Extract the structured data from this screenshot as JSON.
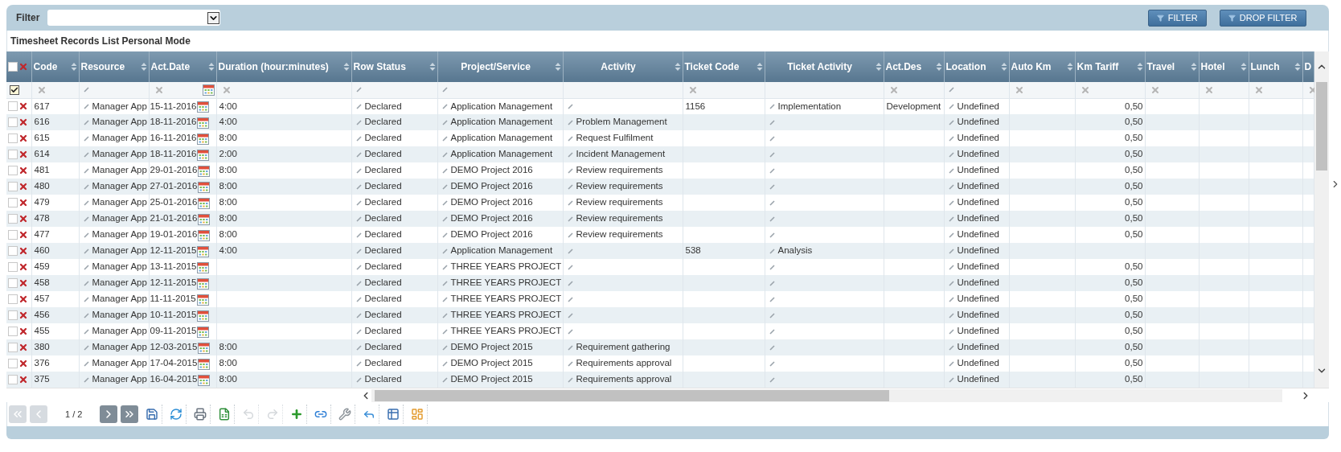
{
  "filter": {
    "label": "Filter"
  },
  "buttons": [
    "FILTER",
    "DROP FILTER"
  ],
  "title": "Timesheet Records List Personal Mode",
  "table": {
    "select_all": {
      "checked": false
    },
    "filter_row": {
      "checked": true,
      "cells": [
        {
          "kind": "clear"
        },
        {
          "kind": "edit"
        },
        {
          "kind": "date"
        },
        {
          "kind": "clear"
        },
        {
          "kind": "edit"
        },
        {
          "kind": "edit"
        },
        {
          "kind": "none"
        },
        {
          "kind": "clear"
        },
        {
          "kind": "none"
        },
        {
          "kind": "clear"
        },
        {
          "kind": "edit"
        },
        {
          "kind": "clear"
        },
        {
          "kind": "clear"
        },
        {
          "kind": "clear"
        },
        {
          "kind": "clear"
        },
        {
          "kind": "clear"
        },
        {
          "kind": "clear"
        }
      ]
    },
    "columns": [
      {
        "label": "Code",
        "kind": "text",
        "centered": false
      },
      {
        "label": "Resource",
        "kind": "edit",
        "centered": false
      },
      {
        "label": "Act.Date",
        "kind": "date",
        "centered": false
      },
      {
        "label": "Duration (hour:minutes)",
        "kind": "text",
        "centered": false
      },
      {
        "label": "Row Status",
        "kind": "edit",
        "centered": false
      },
      {
        "label": "Project/Service",
        "kind": "edit",
        "centered": true
      },
      {
        "label": "Activity",
        "kind": "edit",
        "centered": true
      },
      {
        "label": "Ticket Code",
        "kind": "text",
        "centered": false
      },
      {
        "label": "Ticket Activity",
        "kind": "edit",
        "centered": true
      },
      {
        "label": "Act.Des",
        "kind": "text",
        "centered": false
      },
      {
        "label": "Location",
        "kind": "edit",
        "centered": false
      },
      {
        "label": "Auto Km",
        "kind": "text",
        "centered": false
      },
      {
        "label": "Km Tariff",
        "kind": "number",
        "centered": false
      },
      {
        "label": "Travel",
        "kind": "text",
        "centered": false
      },
      {
        "label": "Hotel",
        "kind": "text",
        "centered": false
      },
      {
        "label": "Lunch",
        "kind": "text",
        "centered": false
      },
      {
        "label": "D",
        "kind": "text",
        "centered": false
      }
    ],
    "rows": [
      {
        "checked": false,
        "code": "617",
        "resource": "Manager App",
        "act_date": "15-11-2016",
        "duration": "4:00",
        "row_status": "Declared",
        "project": "Application Management",
        "ticket_code": "1156",
        "ticket_activity": "Implementation",
        "act_des": "Development",
        "location": "Undefined",
        "km_tariff": "0,50"
      },
      {
        "checked": false,
        "code": "616",
        "resource": "Manager App",
        "act_date": "18-11-2016",
        "duration": "4:00",
        "row_status": "Declared",
        "project": "Application Management",
        "activity": "Problem Management",
        "location": "Undefined",
        "km_tariff": "0,50"
      },
      {
        "checked": false,
        "code": "615",
        "resource": "Manager App",
        "act_date": "16-11-2016",
        "duration": "8:00",
        "row_status": "Declared",
        "project": "Application Management",
        "activity": "Request Fulfilment",
        "location": "Undefined",
        "km_tariff": "0,50"
      },
      {
        "checked": false,
        "code": "614",
        "resource": "Manager App",
        "act_date": "18-11-2016",
        "duration": "2:00",
        "row_status": "Declared",
        "project": "Application Management",
        "activity": "Incident Management",
        "location": "Undefined",
        "km_tariff": "0,50"
      },
      {
        "checked": false,
        "code": "481",
        "resource": "Manager App",
        "act_date": "29-01-2016",
        "duration": "8:00",
        "row_status": "Declared",
        "project": "DEMO Project 2016",
        "activity": "Review requirements",
        "location": "Undefined",
        "km_tariff": "0,50"
      },
      {
        "checked": false,
        "code": "480",
        "resource": "Manager App",
        "act_date": "27-01-2016",
        "duration": "8:00",
        "row_status": "Declared",
        "project": "DEMO Project 2016",
        "activity": "Review requirements",
        "location": "Undefined",
        "km_tariff": "0,50"
      },
      {
        "checked": false,
        "code": "479",
        "resource": "Manager App",
        "act_date": "25-01-2016",
        "duration": "8:00",
        "row_status": "Declared",
        "project": "DEMO Project 2016",
        "activity": "Review requirements",
        "location": "Undefined",
        "km_tariff": "0,50"
      },
      {
        "checked": false,
        "code": "478",
        "resource": "Manager App",
        "act_date": "21-01-2016",
        "duration": "8:00",
        "row_status": "Declared",
        "project": "DEMO Project 2016",
        "activity": "Review requirements",
        "location": "Undefined",
        "km_tariff": "0,50"
      },
      {
        "checked": false,
        "code": "477",
        "resource": "Manager App",
        "act_date": "19-01-2016",
        "duration": "8:00",
        "row_status": "Declared",
        "project": "DEMO Project 2016",
        "activity": "Review requirements",
        "location": "Undefined",
        "km_tariff": "0,50"
      },
      {
        "checked": false,
        "code": "460",
        "resource": "Manager App",
        "act_date": "12-11-2015",
        "duration": "4:00",
        "row_status": "Declared",
        "project": "Application Management",
        "ticket_code": "538",
        "ticket_activity": "Analysis",
        "location": "Undefined"
      },
      {
        "checked": false,
        "code": "459",
        "resource": "Manager App",
        "act_date": "13-11-2015",
        "row_status": "Declared",
        "project": "THREE YEARS PROJECT",
        "location": "Undefined",
        "km_tariff": "0,50"
      },
      {
        "checked": false,
        "code": "458",
        "resource": "Manager App",
        "act_date": "12-11-2015",
        "row_status": "Declared",
        "project": "THREE YEARS PROJECT",
        "location": "Undefined",
        "km_tariff": "0,50"
      },
      {
        "checked": false,
        "code": "457",
        "resource": "Manager App",
        "act_date": "11-11-2015",
        "row_status": "Declared",
        "project": "THREE YEARS PROJECT",
        "location": "Undefined",
        "km_tariff": "0,50"
      },
      {
        "checked": false,
        "code": "456",
        "resource": "Manager App",
        "act_date": "10-11-2015",
        "row_status": "Declared",
        "project": "THREE YEARS PROJECT",
        "location": "Undefined",
        "km_tariff": "0,50"
      },
      {
        "checked": false,
        "code": "455",
        "resource": "Manager App",
        "act_date": "09-11-2015",
        "row_status": "Declared",
        "project": "THREE YEARS PROJECT",
        "location": "Undefined",
        "km_tariff": "0,50"
      },
      {
        "checked": false,
        "code": "380",
        "resource": "Manager App",
        "act_date": "12-03-2015",
        "duration": "8:00",
        "row_status": "Declared",
        "project": "DEMO Project 2015",
        "activity": "Requirement gathering",
        "location": "Undefined",
        "km_tariff": "0,50"
      },
      {
        "checked": false,
        "code": "376",
        "resource": "Manager App",
        "act_date": "17-04-2015",
        "duration": "8:00",
        "row_status": "Declared",
        "project": "DEMO Project 2015",
        "activity": "Requirements approval",
        "location": "Undefined",
        "km_tariff": "0,50"
      },
      {
        "checked": false,
        "code": "375",
        "resource": "Manager App",
        "act_date": "16-04-2015",
        "duration": "8:00",
        "row_status": "Declared",
        "project": "DEMO Project 2015",
        "activity": "Requirements approval",
        "location": "Undefined",
        "km_tariff": "0,50"
      }
    ]
  },
  "pager": {
    "page_label": "1 / 2"
  },
  "toolbar": [
    {
      "kind": "first",
      "disabled": true
    },
    {
      "kind": "previous",
      "disabled": true
    },
    {
      "kind": "next",
      "disabled": false
    },
    {
      "kind": "last",
      "disabled": false
    },
    {
      "kind": "save",
      "disabled": false
    },
    {
      "kind": "refresh",
      "disabled": false
    },
    {
      "kind": "print",
      "disabled": false
    },
    {
      "kind": "excel",
      "disabled": false
    },
    {
      "kind": "undo",
      "disabled": true
    },
    {
      "kind": "redo",
      "disabled": true
    },
    {
      "kind": "add",
      "disabled": false
    },
    {
      "kind": "link",
      "disabled": false
    },
    {
      "kind": "settings",
      "disabled": false
    },
    {
      "kind": "back",
      "disabled": false
    },
    {
      "kind": "grid",
      "disabled": false
    },
    {
      "kind": "chart",
      "disabled": false
    }
  ]
}
